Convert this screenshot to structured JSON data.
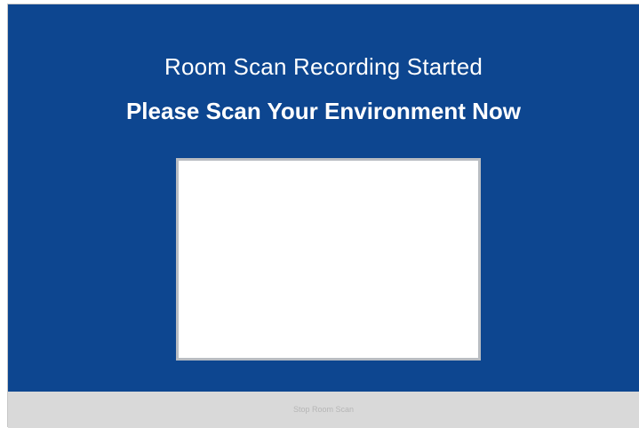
{
  "colors": {
    "panel_background": "#0d4690",
    "footer_background": "#d9d9d9",
    "text_primary": "#ffffff",
    "button_text_disabled": "#b6b6b6"
  },
  "header": {
    "subtitle": "Room Scan Recording Started",
    "title": "Please Scan Your Environment Now"
  },
  "footer": {
    "stop_button_label": "Stop Room Scan"
  }
}
